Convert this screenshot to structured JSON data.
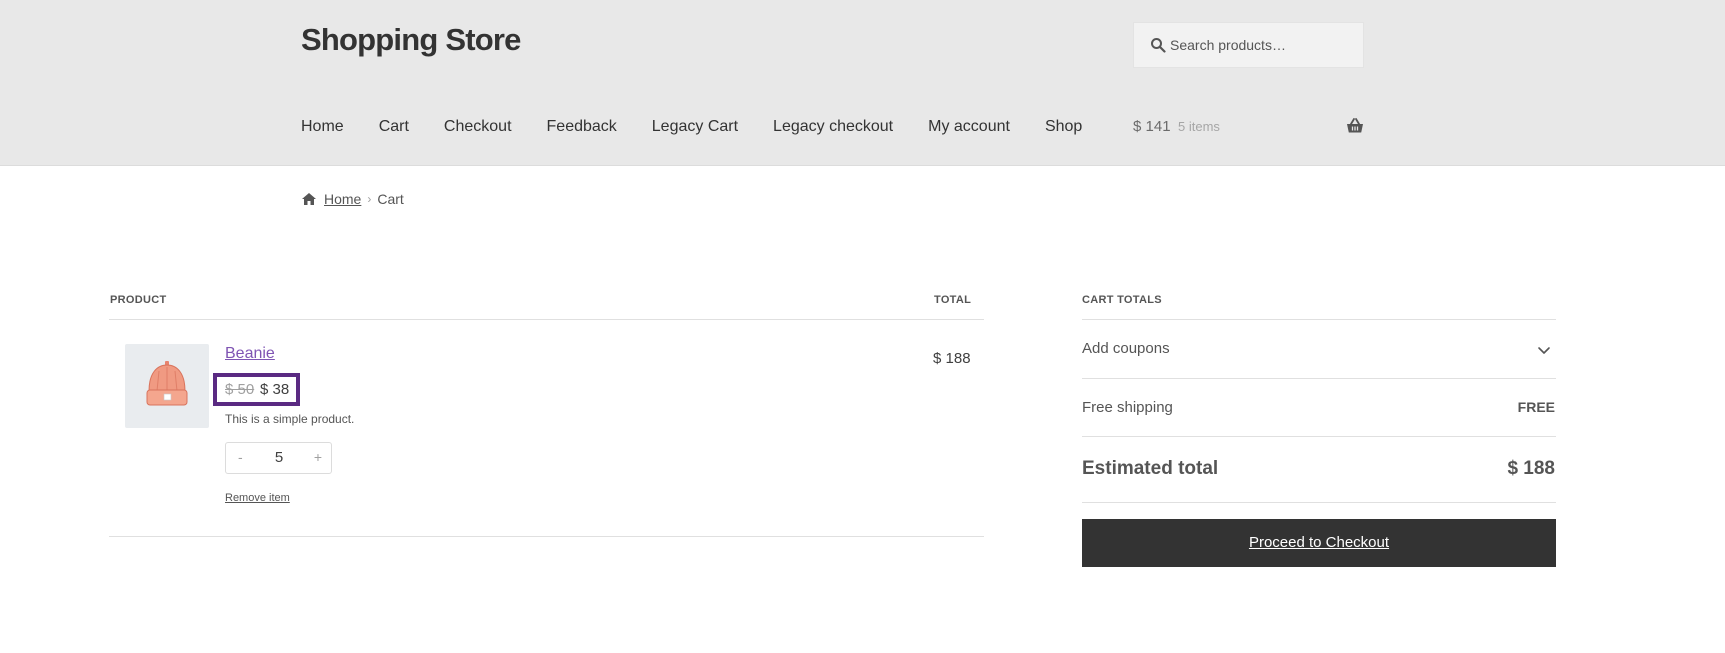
{
  "site": {
    "title": "Shopping Store"
  },
  "search": {
    "placeholder": "Search products…"
  },
  "nav": {
    "items": [
      "Home",
      "Cart",
      "Checkout",
      "Feedback",
      "Legacy Cart",
      "Legacy checkout",
      "My account",
      "Shop"
    ]
  },
  "header_cart": {
    "amount": "$ 141",
    "count": "5 items"
  },
  "breadcrumb": {
    "home": "Home",
    "separator": "›",
    "current": "Cart"
  },
  "cart_table": {
    "headers": {
      "product": "PRODUCT",
      "total": "TOTAL"
    },
    "item": {
      "name": "Beanie",
      "regular_price": "$ 50",
      "sale_price": "$ 38",
      "description": "This is a simple product.",
      "quantity": "5",
      "minus": "-",
      "plus": "+",
      "remove": "Remove item",
      "line_total": "$ 188"
    }
  },
  "totals": {
    "title": "CART TOTALS",
    "coupons": "Add coupons",
    "shipping_label": "Free shipping",
    "shipping_value": "FREE",
    "estimated_label": "Estimated total",
    "estimated_value": "$ 188",
    "checkout_button": "Proceed to Checkout"
  },
  "colors": {
    "header_bg": "#e8e8e8",
    "accent_link": "#7f54b3",
    "highlight_border": "#5a2a82",
    "button_bg": "#333333"
  },
  "icons": [
    "search-icon",
    "basket-icon",
    "home-icon",
    "chevron-down-icon",
    "beanie-image"
  ]
}
